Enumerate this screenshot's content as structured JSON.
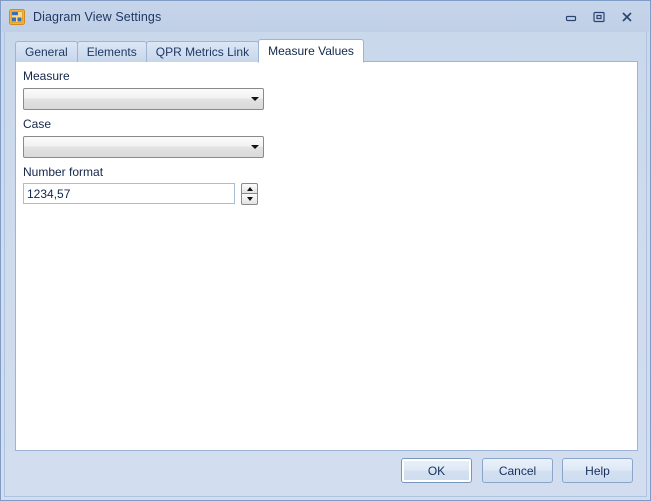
{
  "window": {
    "title": "Diagram View Settings",
    "icon": "diagram-view-settings-icon",
    "controls": {
      "minimize": "minimize-icon",
      "restore": "restore-icon",
      "close": "close-icon"
    }
  },
  "tabs": [
    {
      "label": "General",
      "active": false
    },
    {
      "label": "Elements",
      "active": false
    },
    {
      "label": "QPR Metrics Link",
      "active": false
    },
    {
      "label": "Measure Values",
      "active": true
    }
  ],
  "form": {
    "measure": {
      "label": "Measure",
      "value": "",
      "placeholder": ""
    },
    "case": {
      "label": "Case",
      "value": "",
      "placeholder": ""
    },
    "number_format": {
      "label": "Number format",
      "value": "1234,57",
      "placeholder": "",
      "spinner": {
        "up": "spinner-up-icon",
        "down": "spinner-down-icon"
      }
    }
  },
  "footer": {
    "ok": "OK",
    "cancel": "Cancel",
    "help": "Help"
  },
  "colors": {
    "window_chrome": "#cedbee",
    "titlebar": "#c3d2e8",
    "title_text": "#1f3864",
    "panel": "#ffffff",
    "border": "#9db4d2",
    "button_face": "#dfe9f6"
  }
}
